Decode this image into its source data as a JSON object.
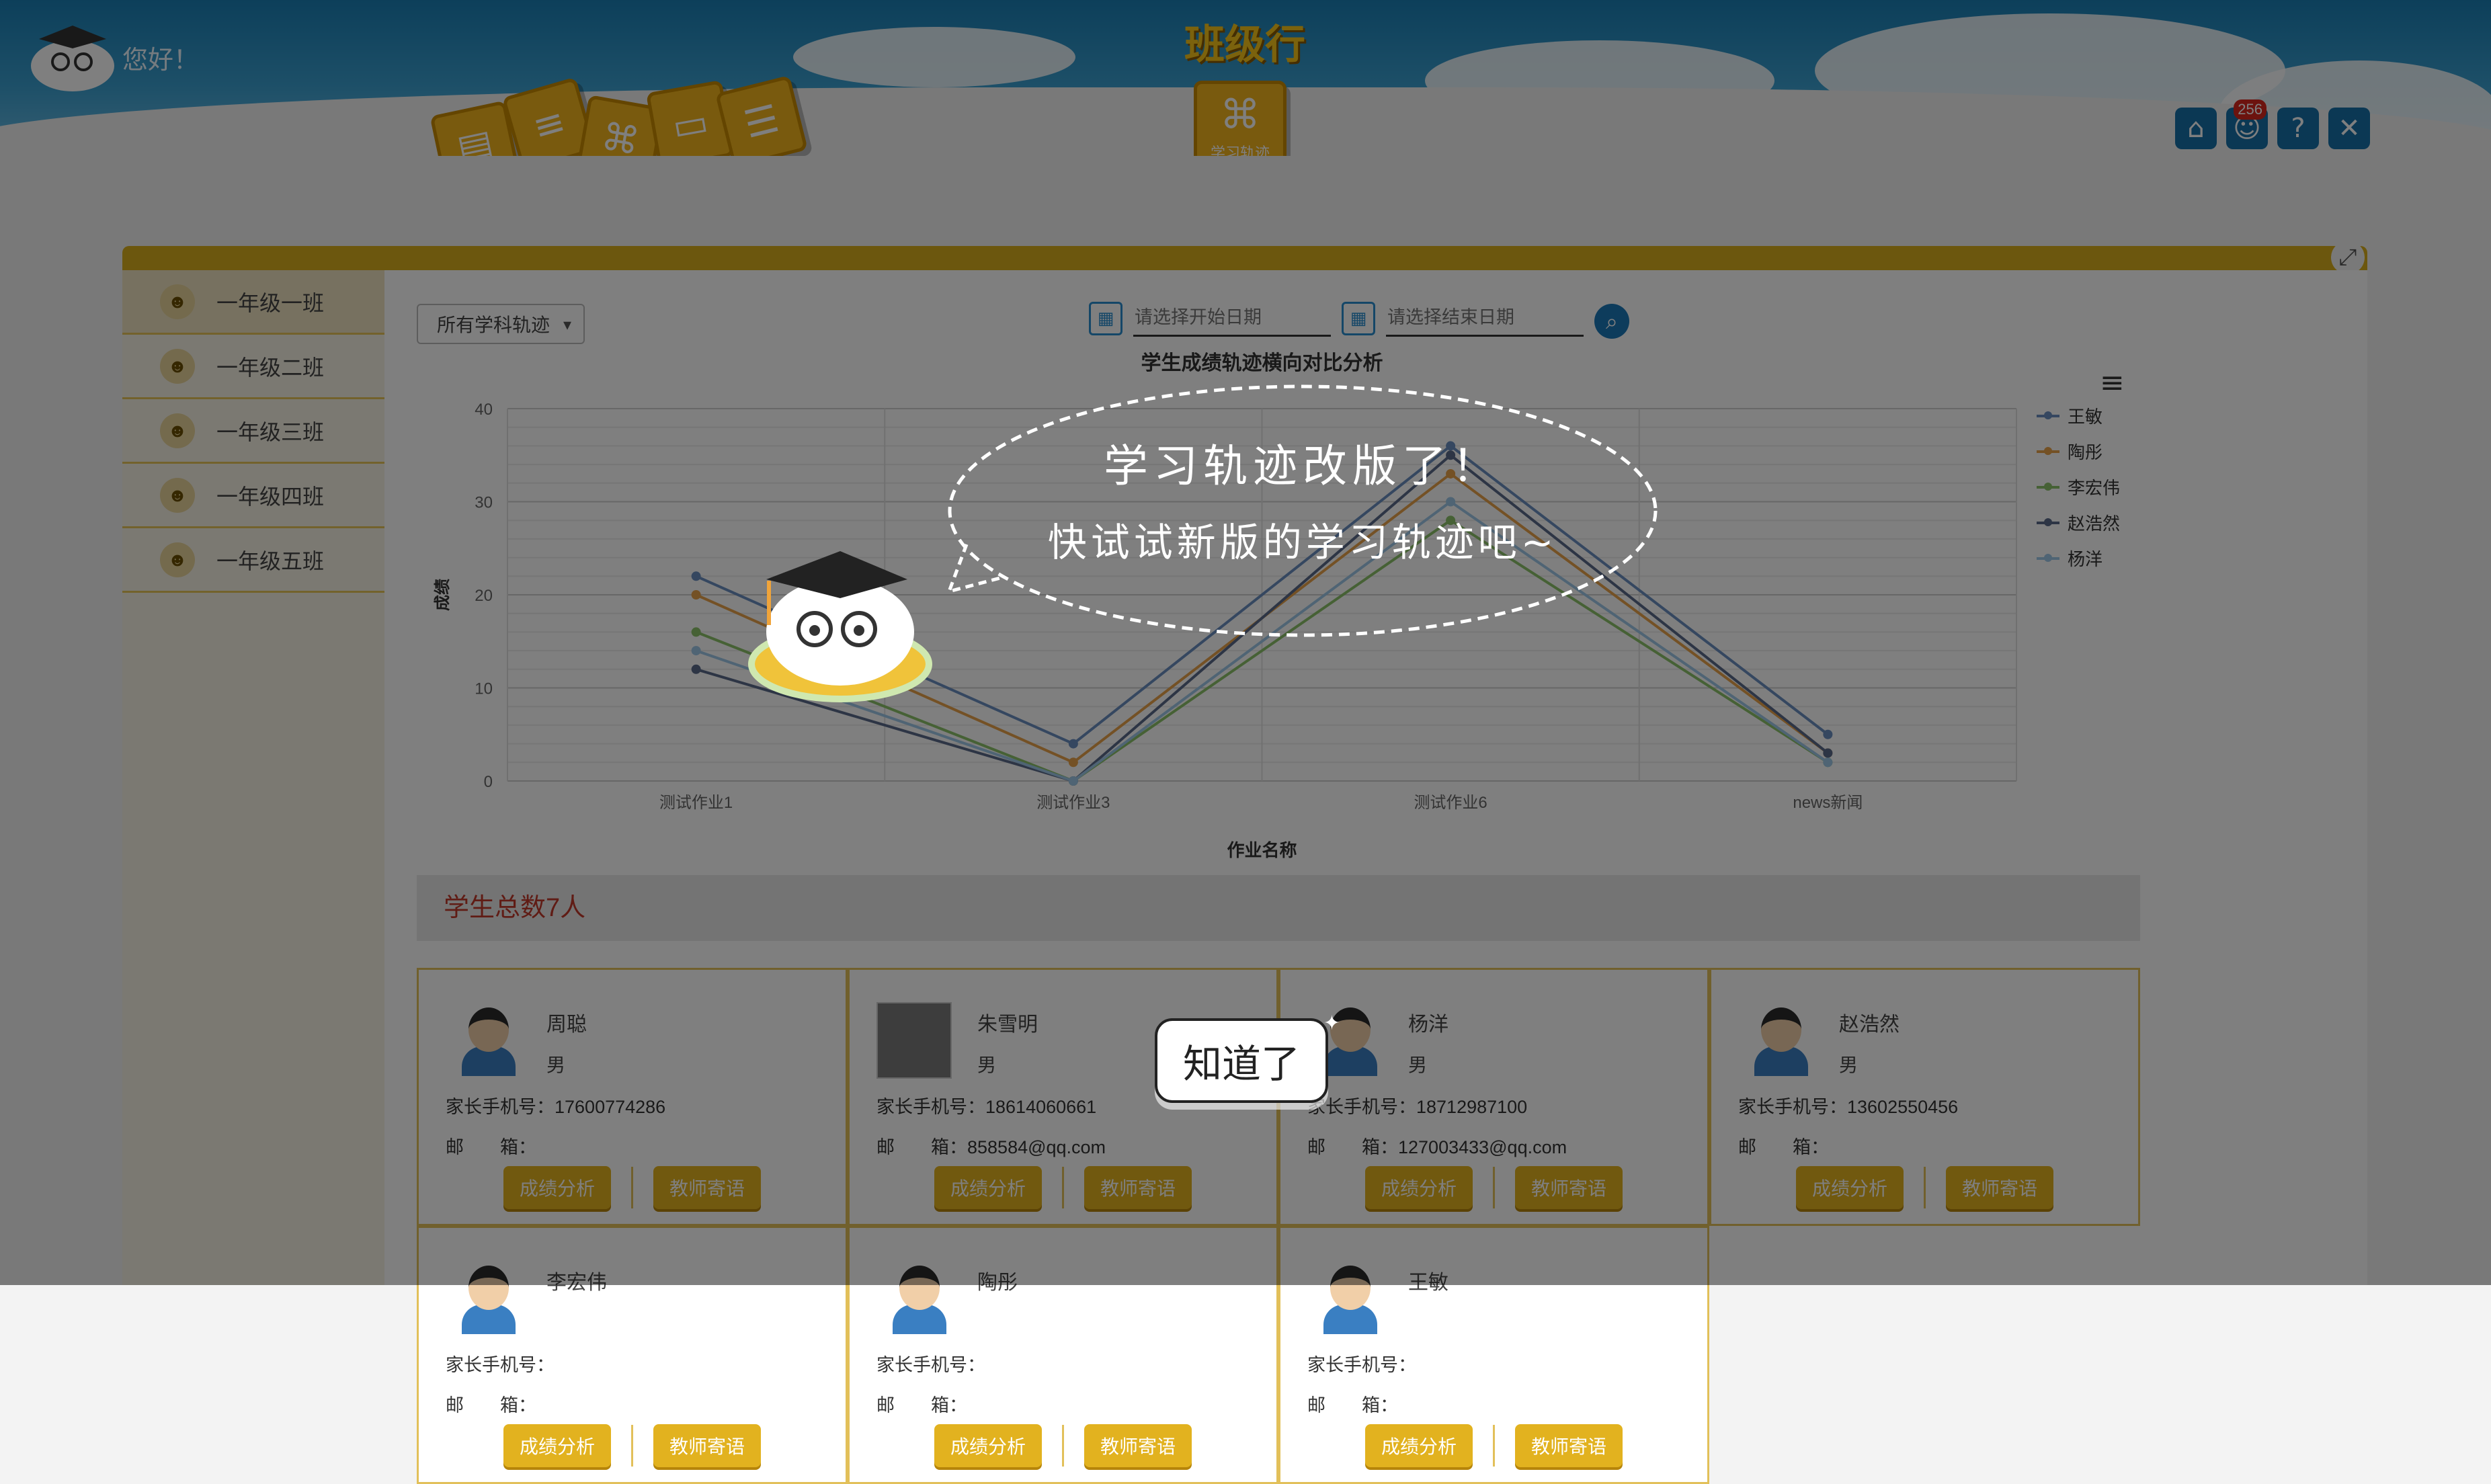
{
  "header": {
    "app_title": "班级行",
    "greeting": "您好！",
    "active_module_label": "学习轨迹",
    "notification_count": "256",
    "nav_tiles": [
      "notebook-icon",
      "books-icon",
      "command-icon",
      "picture-icon",
      "book-stack-icon"
    ],
    "right_icons": [
      "home-icon",
      "user-icon",
      "help-icon",
      "close-icon"
    ]
  },
  "sidebar": {
    "classes": [
      {
        "label": "一年级一班"
      },
      {
        "label": "一年级二班"
      },
      {
        "label": "一年级三班"
      },
      {
        "label": "一年级四班"
      },
      {
        "label": "一年级五班"
      }
    ]
  },
  "filters": {
    "subject_select": "所有学科轨迹",
    "start_date_placeholder": "请选择开始日期",
    "end_date_placeholder": "请选择结束日期"
  },
  "chart_data": {
    "type": "line",
    "title": "学生成绩轨迹横向对比分析",
    "xlabel": "作业名称",
    "ylabel": "成绩",
    "categories": [
      "测试作业1",
      "测试作业3",
      "测试作业6",
      "news新闻"
    ],
    "ylim": [
      0,
      40
    ],
    "yticks": [
      0,
      10,
      20,
      30,
      40
    ],
    "grid": true,
    "legend_position": "right",
    "series": [
      {
        "name": "王敏",
        "color": "#6a8fc0",
        "values": [
          22,
          4,
          36,
          5
        ]
      },
      {
        "name": "陶彤",
        "color": "#e8a24a",
        "values": [
          20,
          2,
          33,
          3
        ]
      },
      {
        "name": "李宏伟",
        "color": "#8cc36a",
        "values": [
          16,
          0,
          28,
          2
        ]
      },
      {
        "name": "赵浩然",
        "color": "#5b6a8a",
        "values": [
          12,
          0,
          35,
          3
        ]
      },
      {
        "name": "杨洋",
        "color": "#9ec8e8",
        "values": [
          14,
          0,
          30,
          2
        ]
      }
    ]
  },
  "students": {
    "total_label": "学生总数7人",
    "score_btn": "成绩分析",
    "message_btn": "教师寄语",
    "phone_label": "家长手机号：",
    "email_label": "邮　　箱：",
    "list": [
      {
        "name": "周聪",
        "gender": "男",
        "phone": "17600774286",
        "email": ""
      },
      {
        "name": "朱雪明",
        "gender": "男",
        "phone": "18614060661",
        "email": "858584@qq.com"
      },
      {
        "name": "杨洋",
        "gender": "男",
        "phone": "18712987100",
        "email": "127003433@qq.com"
      },
      {
        "name": "赵浩然",
        "gender": "男",
        "phone": "13602550456",
        "email": ""
      },
      {
        "name": "李宏伟",
        "gender": "",
        "phone": "",
        "email": ""
      },
      {
        "name": "陶彤",
        "gender": "",
        "phone": "",
        "email": ""
      },
      {
        "name": "王敏",
        "gender": "",
        "phone": "",
        "email": ""
      }
    ]
  },
  "overlay": {
    "line1": "学习轨迹改版了！",
    "line2": "快试试新版的学习轨迹吧~",
    "ok_button": "知道了"
  }
}
